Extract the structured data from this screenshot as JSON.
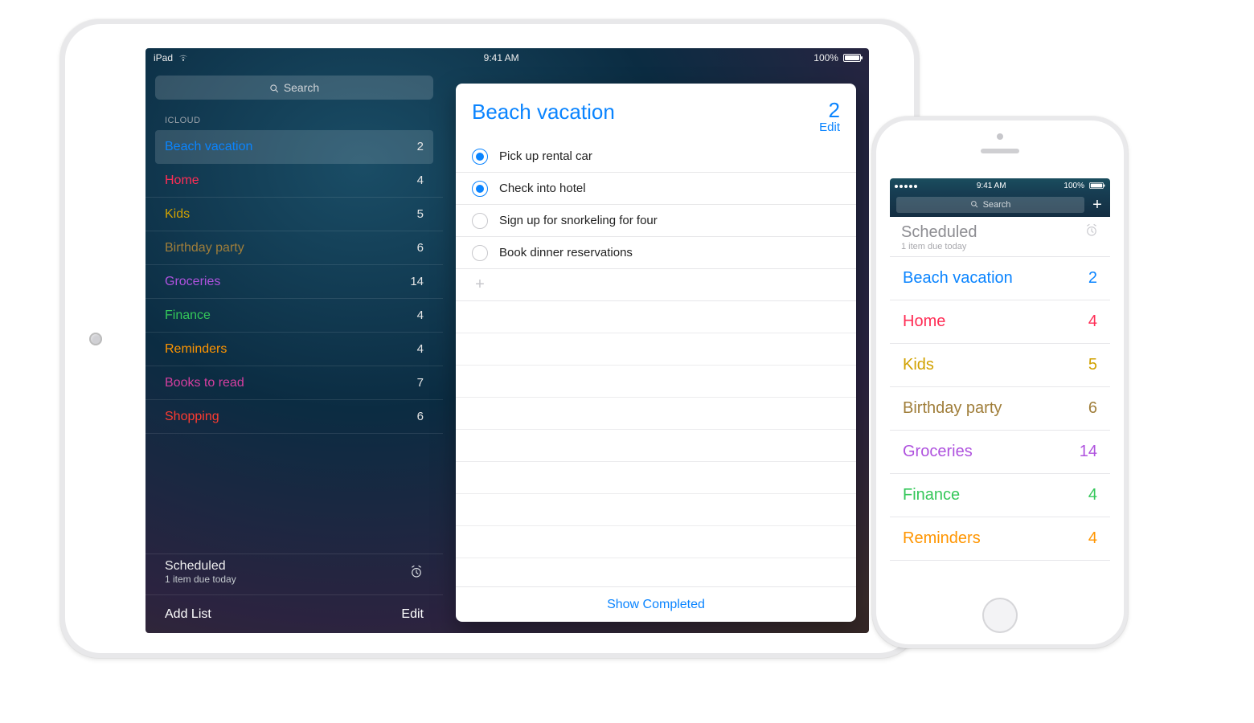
{
  "colors": {
    "blue": "#0a84ff",
    "pink": "#ff2d55",
    "gold": "#d1a100",
    "brown": "#a07e3a",
    "purple": "#af52de",
    "green": "#34c759",
    "orange": "#ff9500",
    "magenta": "#d63fa0",
    "red": "#ff3b30"
  },
  "ipad": {
    "status": {
      "device": "iPad",
      "time": "9:41 AM",
      "battery_pct": "100%"
    },
    "search_placeholder": "Search",
    "section_label": "ICLOUD",
    "lists": [
      {
        "name": "Beach vacation",
        "count": 2,
        "colorKey": "blue",
        "selected": true
      },
      {
        "name": "Home",
        "count": 4,
        "colorKey": "pink"
      },
      {
        "name": "Kids",
        "count": 5,
        "colorKey": "gold"
      },
      {
        "name": "Birthday party",
        "count": 6,
        "colorKey": "brown"
      },
      {
        "name": "Groceries",
        "count": 14,
        "colorKey": "purple"
      },
      {
        "name": "Finance",
        "count": 4,
        "colorKey": "green"
      },
      {
        "name": "Reminders",
        "count": 4,
        "colorKey": "orange"
      },
      {
        "name": "Books to read",
        "count": 7,
        "colorKey": "magenta"
      },
      {
        "name": "Shopping",
        "count": 6,
        "colorKey": "red"
      }
    ],
    "scheduled": {
      "title": "Scheduled",
      "subtitle": "1 item due today"
    },
    "add_list_label": "Add List",
    "edit_label": "Edit",
    "card": {
      "title": "Beach vacation",
      "count": 2,
      "edit_label": "Edit",
      "items": [
        {
          "title": "Pick up rental car",
          "done": true
        },
        {
          "title": "Check into hotel",
          "done": true
        },
        {
          "title": "Sign up for snorkeling for four",
          "done": false
        },
        {
          "title": "Book dinner reservations",
          "done": false
        }
      ],
      "show_completed_label": "Show Completed"
    }
  },
  "iphone": {
    "status": {
      "time": "9:41 AM",
      "battery_pct": "100%"
    },
    "search_placeholder": "Search",
    "scheduled": {
      "title": "Scheduled",
      "subtitle": "1 item due today"
    },
    "lists": [
      {
        "name": "Beach vacation",
        "count": 2,
        "colorKey": "blue"
      },
      {
        "name": "Home",
        "count": 4,
        "colorKey": "pink"
      },
      {
        "name": "Kids",
        "count": 5,
        "colorKey": "gold"
      },
      {
        "name": "Birthday party",
        "count": 6,
        "colorKey": "brown"
      },
      {
        "name": "Groceries",
        "count": 14,
        "colorKey": "purple"
      },
      {
        "name": "Finance",
        "count": 4,
        "colorKey": "green"
      },
      {
        "name": "Reminders",
        "count": 4,
        "colorKey": "orange"
      }
    ]
  }
}
